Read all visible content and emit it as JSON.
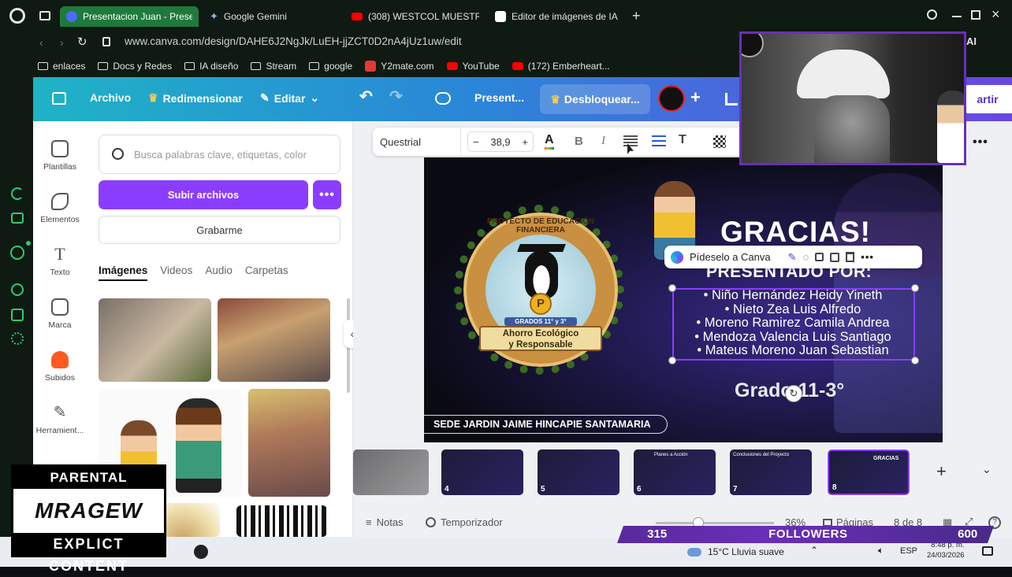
{
  "browser": {
    "tabs": [
      {
        "label": "Presentacion Juan - Prese",
        "active": true,
        "favicon_color": "#4a6cf7"
      },
      {
        "label": "Google Gemini",
        "active": false,
        "favicon_color": "#8ab4f8"
      },
      {
        "label": "(308) WESTCOL MUESTR",
        "active": false,
        "favicon_color": "#ff0000"
      },
      {
        "label": "Editor de imágenes de IA",
        "active": false,
        "favicon_color": "#ffffff"
      }
    ],
    "url": "www.canva.com/design/DAHE6J2NgJk/LuEH-jjZCT0D2nA4jUz1uw/edit",
    "bookmarks": [
      "enlaces",
      "Docs y Redes",
      "IA diseño",
      "Stream",
      "google",
      "Y2mate.com",
      "YouTube",
      "(172) Emberheart..."
    ],
    "profile_partial": "AI"
  },
  "canva": {
    "menu": {
      "file": "Archivo",
      "resize": "Redimensionar",
      "edit": "Editar",
      "title": "Present...",
      "unlock": "Desbloquear...",
      "share": "artir"
    },
    "sidenav": [
      "Plantillas",
      "Elementos",
      "Texto",
      "Marca",
      "Subidos",
      "Herramient..."
    ],
    "panel": {
      "search_placeholder": "Busca palabras clave, etiquetas, color",
      "upload": "Subir archivos",
      "more": "•••",
      "record": "Grabarme",
      "tabs": [
        "Imágenes",
        "Videos",
        "Audio",
        "Carpetas"
      ]
    },
    "texttoolbar": {
      "font": "Questrial",
      "size": "38,9",
      "minus": "−",
      "plus": "+"
    },
    "slide": {
      "title": "GRACIAS!",
      "presented_by": "PRESENTADO POR:",
      "names": [
        "Niño Hernández Heidy Yineth",
        "Nieto Zea Luis Alfredo",
        "Moreno Ramirez Camila Andrea",
        "Mendoza Valencia Luis Santiago",
        "Mateus Moreno Juan Sebastian"
      ],
      "grade": "Grado 11-3°",
      "footer": "SEDE JARDIN JAIME HINCAPIE SANTAMARIA",
      "ai_prompt": "Pídeselo a Canva",
      "seal_top": "PROYECTO DE EDUCACIÓN FINANCIERA",
      "seal_banner_1": "Ahorro Ecológico",
      "seal_banner_2": "y Responsable",
      "seal_grades": "GRADOS 11° y 3°"
    },
    "thumbnails": [
      {
        "num": "4",
        "caption": ""
      },
      {
        "num": "5",
        "caption": ""
      },
      {
        "num": "6",
        "caption": "Planes a Acción"
      },
      {
        "num": "7",
        "caption": "Conclusiones del Proyecto"
      },
      {
        "num": "8",
        "caption": "GRACIAS"
      }
    ],
    "bottom": {
      "notes": "Notas",
      "timer": "Temporizador",
      "zoom": "36%",
      "pages_label": "Páginas",
      "page_count": "8 de 8",
      "zoom_value": 36
    }
  },
  "stream": {
    "followers_left": "315",
    "followers_label": "FOLLOWERS",
    "followers_right": "600",
    "advisory_top": "PARENTAL ADVISORY",
    "advisory_logo": "MRAGEW",
    "advisory_bottom": "EXPLICT CONTENT"
  },
  "taskbar": {
    "weather": "15°C Lluvia suave",
    "lang": "ESP",
    "time": "8:48 p. m.",
    "date": "24/03/2026"
  },
  "colors": {
    "canva_purple": "#8b3dff",
    "browser_green": "#1f7a3c",
    "followers_purple": "#6a2fb8"
  }
}
